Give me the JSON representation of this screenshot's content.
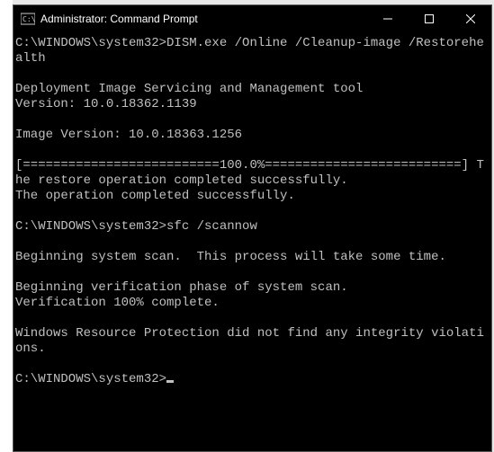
{
  "titlebar": {
    "title": "Administrator: Command Prompt"
  },
  "terminal": {
    "line1": "C:\\WINDOWS\\system32>DISM.exe /Online /Cleanup-image /Restorehealth",
    "blank1": "",
    "line2": "Deployment Image Servicing and Management tool",
    "line3": "Version: 10.0.18362.1139",
    "blank2": "",
    "line4": "Image Version: 10.0.18363.1256",
    "blank3": "",
    "line5": "[==========================100.0%==========================] The restore operation completed successfully.",
    "line6": "The operation completed successfully.",
    "blank4": "",
    "line7": "C:\\WINDOWS\\system32>sfc /scannow",
    "blank5": "",
    "line8": "Beginning system scan.  This process will take some time.",
    "blank6": "",
    "line9": "Beginning verification phase of system scan.",
    "line10": "Verification 100% complete.",
    "blank7": "",
    "line11": "Windows Resource Protection did not find any integrity violations.",
    "blank8": "",
    "prompt": "C:\\WINDOWS\\system32>"
  }
}
